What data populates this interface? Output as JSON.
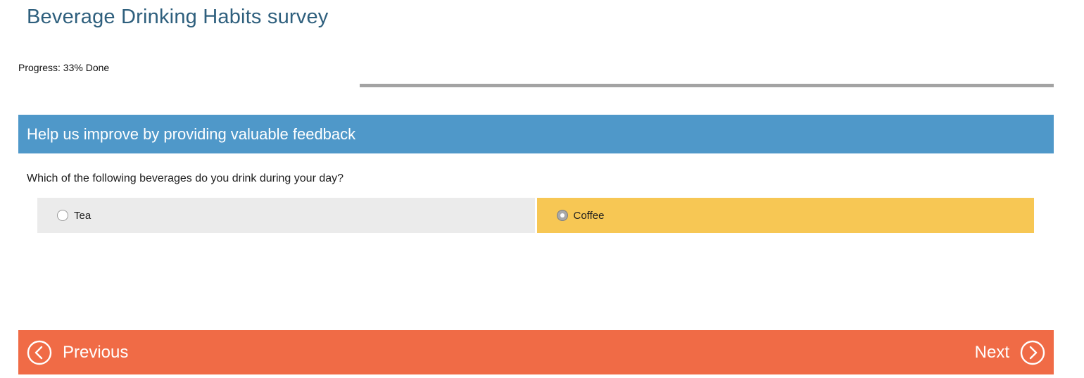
{
  "survey": {
    "title": "Beverage Drinking Habits survey"
  },
  "progress": {
    "label": "Progress: 33% Done",
    "percent": 33
  },
  "section": {
    "title": "Help us improve by providing valuable feedback",
    "color": "#4f98c9"
  },
  "question": {
    "text": "Which of the following beverages do you drink during your day?",
    "options": [
      {
        "label": "Tea",
        "selected": false,
        "color": "#ebebeb"
      },
      {
        "label": "Coffee",
        "selected": true,
        "color": "#f7c754"
      }
    ]
  },
  "navigation": {
    "previous_label": "Previous",
    "next_label": "Next",
    "previous_icon": "chevron-left-circle-icon",
    "next_icon": "chevron-right-circle-icon",
    "color": "#f06b46"
  },
  "colors": {
    "title": "#2e5f7d",
    "progress_track": "#a3a3a3"
  }
}
